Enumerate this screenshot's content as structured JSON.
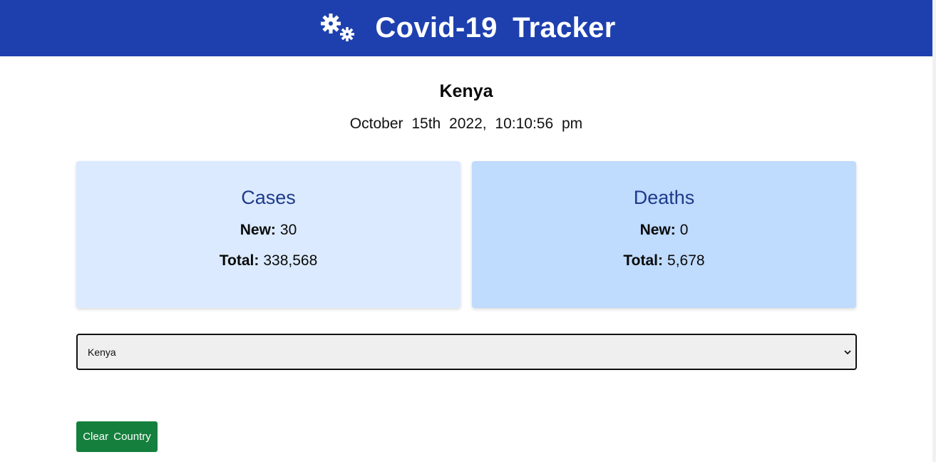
{
  "header": {
    "title": "Covid-19 Tracker",
    "logo_icon": "virus-gears-icon",
    "background": "#1e40af"
  },
  "main": {
    "country": "Kenya",
    "timestamp": "October 15th 2022, 10:10:56 pm"
  },
  "cards": {
    "cases": {
      "title": "Cases",
      "new_label": "New:",
      "new_value": "30",
      "total_label": "Total:",
      "total_value": "338,568",
      "background": "#dbeafe"
    },
    "deaths": {
      "title": "Deaths",
      "new_label": "New:",
      "new_value": "0",
      "total_label": "Total:",
      "total_value": "5,678",
      "background": "#bfdbfe"
    }
  },
  "country_select": {
    "selected": "Kenya",
    "icon": "chevron-down-icon"
  },
  "actions": {
    "clear_label": "Clear Country",
    "clear_color": "#15803d"
  }
}
